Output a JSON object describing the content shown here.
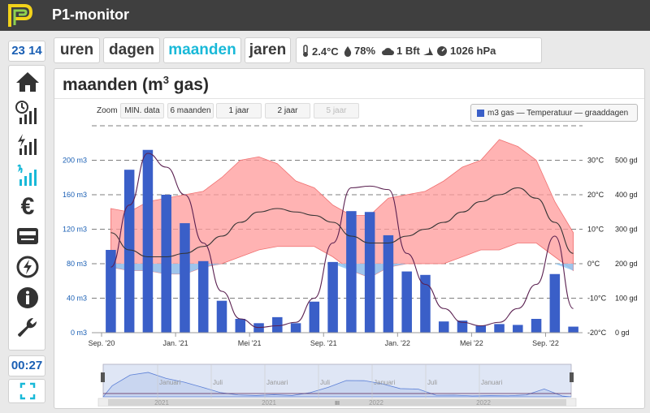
{
  "app": {
    "title": "P1-monitor"
  },
  "sidebar": {
    "clock": "23 14",
    "timer": "00:27",
    "items": [
      {
        "icon": "home-icon"
      },
      {
        "icon": "realtime-power-icon"
      },
      {
        "icon": "power-history-icon"
      },
      {
        "icon": "gas-history-icon",
        "active": true
      },
      {
        "icon": "euro-icon"
      },
      {
        "icon": "meter-icon"
      },
      {
        "icon": "solar-power-icon"
      },
      {
        "icon": "info-icon"
      },
      {
        "icon": "settings-wrench-icon"
      }
    ]
  },
  "tabs": [
    {
      "label": "uren",
      "active": false
    },
    {
      "label": "dagen",
      "active": false
    },
    {
      "label": "maanden",
      "active": true
    },
    {
      "label": "jaren",
      "active": false
    }
  ],
  "weather": {
    "temperature": "2.4°C",
    "humidity": "78%",
    "wind": "1 Bft",
    "pressure": "1026 hPa"
  },
  "panel": {
    "title": "maanden (m",
    "title_sup": "3",
    "title_suffix": " gas)"
  },
  "zoom": {
    "label": "Zoom",
    "buttons": [
      {
        "label": "MIN. data",
        "enabled": true
      },
      {
        "label": "6 maanden",
        "enabled": true
      },
      {
        "label": "1 jaar",
        "enabled": true
      },
      {
        "label": "2 jaar",
        "enabled": true
      },
      {
        "label": "5 jaar",
        "enabled": false
      }
    ]
  },
  "legend": {
    "text": "m3 gas — Temperatuur — graaddagen"
  },
  "colors": {
    "accent": "#19b9d8",
    "bar": "#3a5fc8",
    "band": "#ff9a9a",
    "band_below": "#8ec8f5",
    "navy": "#1a5fb4"
  },
  "chart_data": {
    "type": "bar",
    "months": [
      "2020-09",
      "2020-10",
      "2020-11",
      "2020-12",
      "2021-01",
      "2021-02",
      "2021-03",
      "2021-04",
      "2021-05",
      "2021-06",
      "2021-07",
      "2021-08",
      "2021-09",
      "2021-10",
      "2021-11",
      "2021-12",
      "2022-01",
      "2022-02",
      "2022-03",
      "2022-04",
      "2022-05",
      "2022-06",
      "2022-07",
      "2022-08",
      "2022-09",
      "2022-10",
      "2022-11",
      "2022-12"
    ],
    "x_ticks": [
      "Sep. '20",
      "Jan. '21",
      "Mei '21",
      "Sep. '21",
      "Jan. '22",
      "Mei '22",
      "Sep. '22"
    ],
    "y_left": {
      "ticks": [
        "0 m3",
        "40 m3",
        "80 m3",
        "120 m3",
        "160 m3",
        "200 m3"
      ],
      "range": [
        0,
        240
      ]
    },
    "y_right_temp": {
      "ticks": [
        "-20°C",
        "-10°C",
        "0°C",
        "10°C",
        "20°C",
        "30°C"
      ],
      "range": [
        -20,
        40
      ]
    },
    "y_right_gd": {
      "ticks": [
        "0 gd",
        "100 gd",
        "200 gd",
        "300 gd",
        "400 gd",
        "500 gd"
      ],
      "range": [
        0,
        600
      ]
    },
    "series": [
      {
        "name": "m3 gas",
        "values": [
          96,
          189,
          212,
          160,
          127,
          83,
          37,
          16,
          11,
          18,
          11,
          36,
          82,
          141,
          140,
          113,
          71,
          67,
          13,
          14,
          8,
          10,
          9,
          16,
          68,
          7
        ]
      },
      {
        "name": "Temperatuur",
        "type": "line",
        "values": [
          9,
          4,
          2,
          2,
          3,
          5,
          8,
          12,
          15,
          16,
          15,
          14,
          12,
          8,
          6,
          6,
          8,
          10,
          12,
          15,
          18,
          20,
          22,
          19,
          12,
          3
        ]
      },
      {
        "name": "graaddagen",
        "type": "line",
        "values": [
          190,
          370,
          520,
          480,
          400,
          260,
          120,
          40,
          15,
          20,
          30,
          100,
          260,
          420,
          425,
          415,
          230,
          140,
          70,
          30,
          20,
          30,
          70,
          140,
          280,
          70
        ]
      },
      {
        "name": "temperature range",
        "type": "area",
        "low": [
          -1,
          -2,
          -2,
          -3,
          -3,
          -1,
          0,
          2,
          4,
          5,
          5,
          5,
          2,
          -2,
          -4,
          -1,
          0,
          0,
          0,
          2,
          4,
          4,
          6,
          6,
          2,
          -2
        ],
        "high": [
          16,
          15,
          18,
          19,
          20,
          21,
          25,
          30,
          31,
          29,
          24,
          22,
          17,
          14,
          14,
          19,
          20,
          21,
          24,
          28,
          30,
          36,
          34,
          30,
          18,
          9
        ]
      }
    ],
    "navigator": {
      "labels": [
        "Januari",
        "Juli",
        "Januari",
        "Juli",
        "Januari",
        "Juli",
        "Januari"
      ],
      "years": [
        "2021",
        "2021",
        "2022",
        "2022"
      ]
    }
  }
}
